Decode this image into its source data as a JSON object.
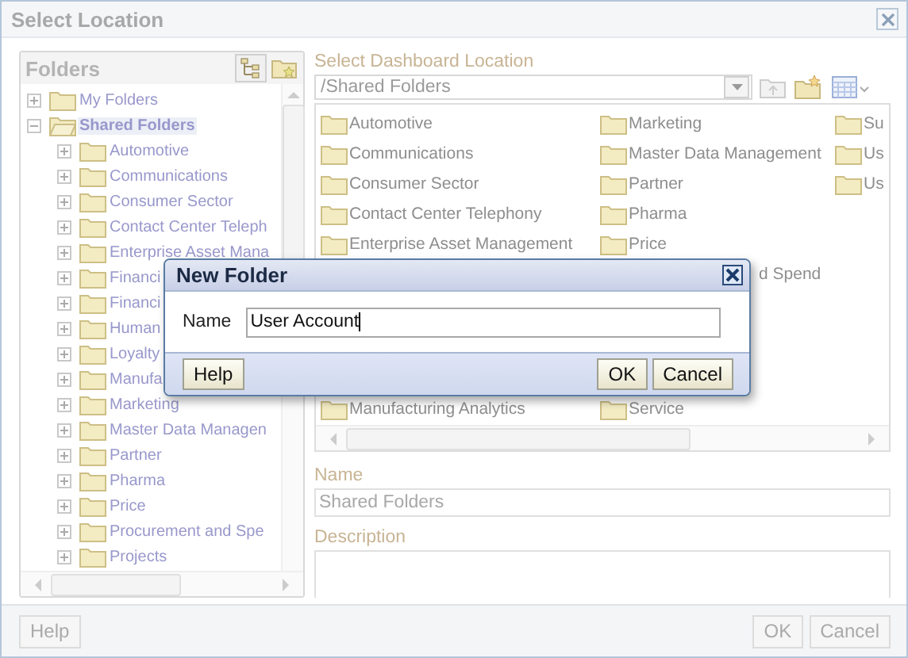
{
  "window": {
    "title": "Select Location"
  },
  "folders_panel": {
    "title": "Folders",
    "tree": [
      {
        "label": "My Folders",
        "expanded": false,
        "selected": false
      },
      {
        "label": "Shared Folders",
        "expanded": true,
        "selected": true,
        "children": [
          {
            "label": "Automotive",
            "expanded": false,
            "selected": false
          },
          {
            "label": "Communications",
            "expanded": false,
            "selected": false
          },
          {
            "label": "Consumer Sector",
            "expanded": false,
            "selected": false
          },
          {
            "label": "Contact Center Teleph",
            "expanded": false,
            "selected": false
          },
          {
            "label": "Enterprise Asset Mana",
            "expanded": false,
            "selected": false
          },
          {
            "label": "Financi",
            "expanded": false,
            "selected": false
          },
          {
            "label": "Financi",
            "expanded": false,
            "selected": false
          },
          {
            "label": "Human",
            "expanded": false,
            "selected": false
          },
          {
            "label": "Loyalty",
            "expanded": false,
            "selected": false
          },
          {
            "label": "Manufa",
            "expanded": false,
            "selected": false
          },
          {
            "label": "Marketing",
            "expanded": false,
            "selected": false
          },
          {
            "label": "Master Data Managen",
            "expanded": false,
            "selected": false
          },
          {
            "label": "Partner",
            "expanded": false,
            "selected": false
          },
          {
            "label": "Pharma",
            "expanded": false,
            "selected": false
          },
          {
            "label": "Price",
            "expanded": false,
            "selected": false
          },
          {
            "label": "Procurement and Spe",
            "expanded": false,
            "selected": false
          },
          {
            "label": "Projects",
            "expanded": false,
            "selected": false
          }
        ]
      }
    ]
  },
  "location_panel": {
    "label": "Select Dashboard Location",
    "path": "/Shared Folders",
    "columns": [
      {
        "items": [
          {
            "label": "Automotive",
            "kind": "folder"
          },
          {
            "label": "Communications",
            "kind": "folder"
          },
          {
            "label": "Consumer Sector",
            "kind": "folder"
          },
          {
            "label": "Contact Center Telephony",
            "kind": "folder"
          },
          {
            "label": "Enterprise Asset Management",
            "kind": "folder"
          }
        ]
      },
      {
        "items": [
          {
            "label": "Marketing",
            "kind": "folder"
          },
          {
            "label": "Master Data Management",
            "kind": "folder"
          },
          {
            "label": "Partner",
            "kind": "folder"
          },
          {
            "label": "Pharma",
            "kind": "folder"
          },
          {
            "label": "Price",
            "kind": "folder"
          },
          {
            "label": "d Spend",
            "kind": "text"
          }
        ]
      },
      {
        "items": [
          {
            "label": "Su",
            "kind": "folder"
          },
          {
            "label": "Us",
            "kind": "folder"
          },
          {
            "label": "Us",
            "kind": "folder"
          }
        ]
      }
    ],
    "last_row": [
      {
        "label": "Manufacturing Analytics",
        "kind": "folder"
      },
      {
        "label": "Service",
        "kind": "folder"
      }
    ],
    "name_label": "Name",
    "name_value": "Shared Folders",
    "description_label": "Description"
  },
  "buttons": {
    "help": "Help",
    "ok": "OK",
    "cancel": "Cancel"
  },
  "new_folder_dialog": {
    "title": "New Folder",
    "name_label": "Name",
    "name_value": "User Account",
    "buttons": {
      "help": "Help",
      "ok": "OK",
      "cancel": "Cancel"
    }
  }
}
